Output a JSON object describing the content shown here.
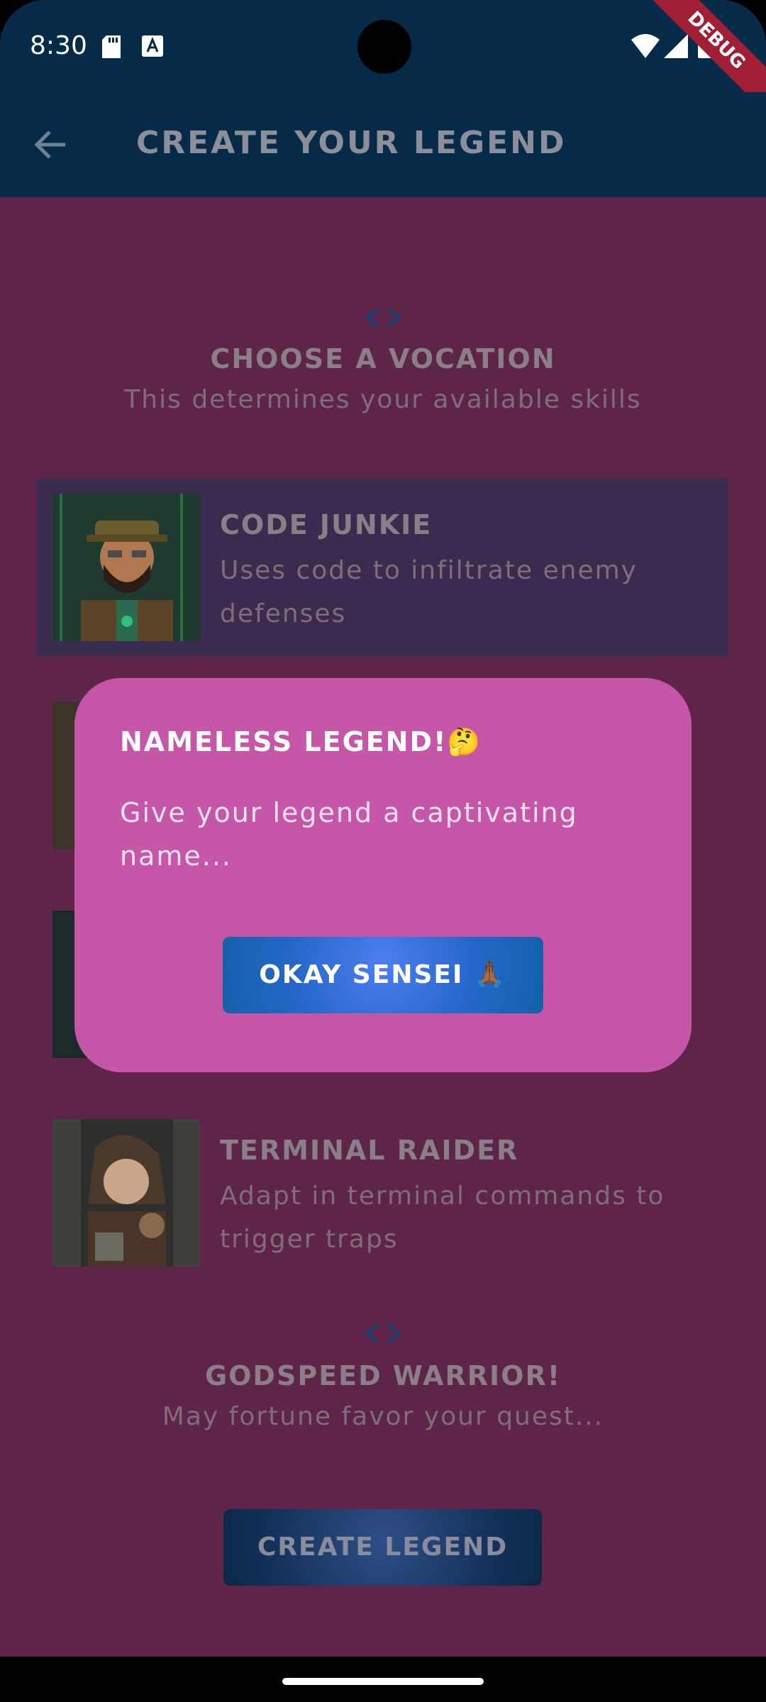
{
  "status_bar": {
    "time": "8:30",
    "debug_banner": "DEBUG"
  },
  "app_bar": {
    "title": "CREATE YOUR LEGEND"
  },
  "vocation_section": {
    "title": "CHOOSE A VOCATION",
    "subtitle": "This determines your available skills"
  },
  "vocations": [
    {
      "title": "CODE JUNKIE",
      "description": "Uses code to infiltrate enemy defenses",
      "selected": true
    },
    {
      "title": "TERMINAL RAIDER",
      "description": "Adapt in terminal commands to trigger traps",
      "selected": false
    }
  ],
  "footer_section": {
    "title": "GODSPEED WARRIOR!",
    "subtitle": "May fortune favor your quest..."
  },
  "create_button": {
    "label": "CREATE LEGEND"
  },
  "dialog": {
    "title": "NAMELESS LEGEND!🤔",
    "message": "Give your legend a captivating name...",
    "button_label": "OKAY SENSEI 🙏🏾"
  },
  "colors": {
    "background": "#5e2548",
    "app_bar": "#062b48",
    "dialog": "#c556a8",
    "accent_button": "#2467c8"
  }
}
